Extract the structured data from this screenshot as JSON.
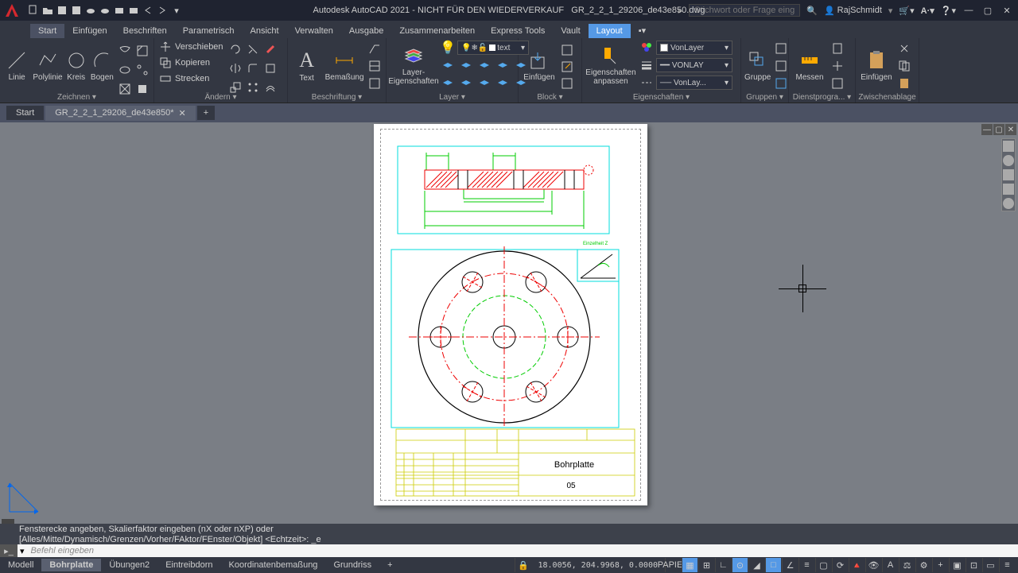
{
  "title": "Autodesk AutoCAD 2021 - NICHT FÜR DEN WIEDERVERKAUF",
  "filename": "GR_2_2_1_29206_de43e850.dwg",
  "search_placeholder": "Stichwort oder Frage eingeben",
  "user": "RajSchmidt",
  "tabs": [
    "Start",
    "Einfügen",
    "Beschriften",
    "Parametrisch",
    "Ansicht",
    "Verwalten",
    "Ausgabe",
    "Zusammenarbeiten",
    "Express Tools",
    "Vault",
    "Layout"
  ],
  "panels": {
    "zeichnen": "Zeichnen",
    "aendern": "Ändern",
    "beschriftung": "Beschriftung",
    "layer": "Layer",
    "block": "Block",
    "eigenschaften": "Eigenschaften",
    "gruppen": "Gruppen",
    "dienst": "Dienstprogra...",
    "zwischen": "Zwischenablage"
  },
  "draw": {
    "linie": "Linie",
    "polylinie": "Polylinie",
    "kreis": "Kreis",
    "bogen": "Bogen"
  },
  "modify": {
    "verschieben": "Verschieben",
    "kopieren": "Kopieren",
    "strecken": "Strecken"
  },
  "annot": {
    "text": "Text",
    "bem": "Bemaßung"
  },
  "layer": {
    "btn": "Layer-\nEigenschaften",
    "current": "text"
  },
  "block": {
    "einf": "Einfügen"
  },
  "prop": {
    "btn": "Eigenschaften\nanpassen",
    "bylayer": "VonLayer",
    "vl2": "VONLAY",
    "vl3": "VonLay..."
  },
  "grp": {
    "btn": "Gruppe"
  },
  "util": {
    "messen": "Messen"
  },
  "clip": {
    "einf": "Einfügen"
  },
  "filetabs": {
    "start": "Start",
    "file": "GR_2_2_1_29206_de43e850*"
  },
  "drawing": {
    "title": "Bohrplatte",
    "num": "05"
  },
  "cmd": {
    "hist1": "Fensterecke angeben, Skalierfaktor eingeben (nX oder nXP) oder",
    "hist2": "[Alles/Mitte/Dynamisch/Grenzen/Vorher/FAktor/FEnster/Objekt] <Echtzeit>: _e",
    "prompt": "Befehl eingeben"
  },
  "layouts": [
    "Modell",
    "Bohrplatte",
    "Übungen2",
    "Eintreibdorn",
    "Koordinatenbemaßung",
    "Grundriss"
  ],
  "status": {
    "coord": "18.0056, 204.9968, 0.0000",
    "space": "PAPIER"
  }
}
